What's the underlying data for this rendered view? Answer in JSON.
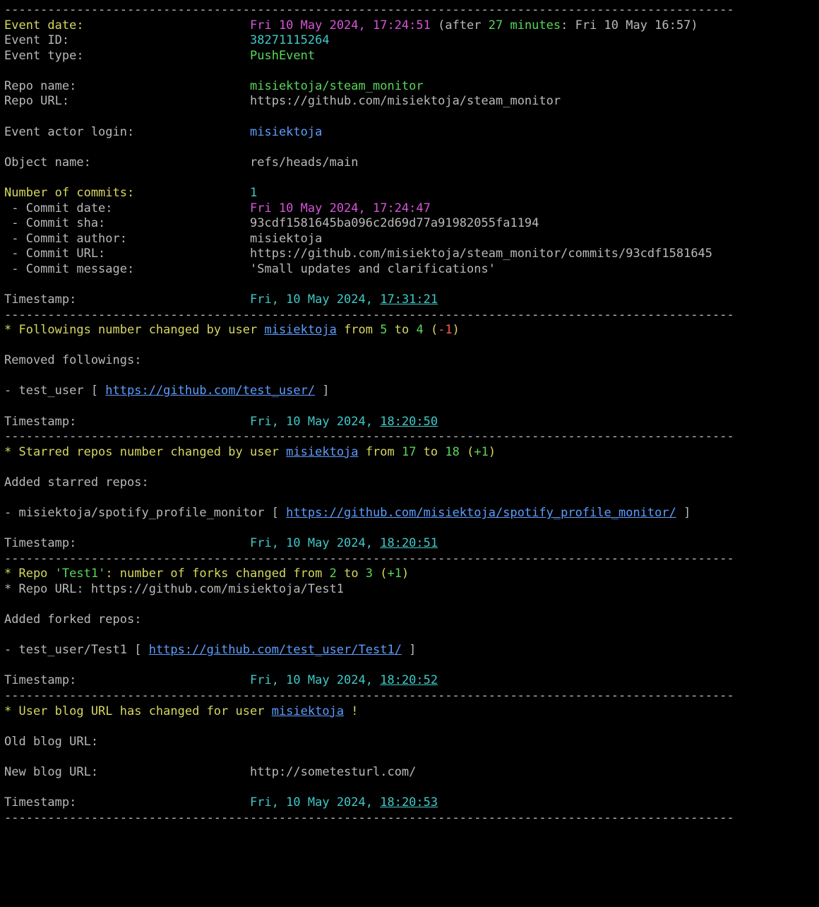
{
  "hr": "-----------------------------------------------------------------------------------------------------",
  "labels": {
    "event_date": "Event date:",
    "event_id": "Event ID:",
    "event_type": "Event type:",
    "repo_name": "Repo name:",
    "repo_url": "Repo URL:",
    "actor": "Event actor login:",
    "object_name": "Object name:",
    "num_commits": "Number of commits:",
    "commit_date": " - Commit date:",
    "commit_sha": " - Commit sha:",
    "commit_author": " - Commit author:",
    "commit_url": " - Commit URL:",
    "commit_msg": " - Commit message:",
    "timestamp": "Timestamp:",
    "removed_followings": "Removed followings:",
    "added_starred": "Added starred repos:",
    "added_forked": "Added forked repos:",
    "old_blog": "Old blog URL:",
    "new_blog": "New blog URL:"
  },
  "event": {
    "date": "Fri 10 May 2024, 17:24:51",
    "after_prefix": " (after ",
    "after_value": "27 minutes",
    "after_suffix": ": Fri 10 May 16:57)",
    "id": "38271115264",
    "type": "PushEvent",
    "repo_name": "misiektoja/steam_monitor",
    "repo_url": "https://github.com/misiektoja/steam_monitor",
    "actor": "misiektoja",
    "object_name": "refs/heads/main",
    "num_commits": "1",
    "commit_date": "Fri 10 May 2024, 17:24:47",
    "commit_sha": "93cdf1581645ba096c2d69d77a91982055fa1194",
    "commit_author": "misiektoja",
    "commit_url": "https://github.com/misiektoja/steam_monitor/commits/93cdf1581645",
    "commit_msg": "'Small updates and clarifications'",
    "ts_prefix": "Fri, 10 May 2024, ",
    "ts_time": "17:31:21"
  },
  "followings": {
    "prefix": "* Followings number changed by user ",
    "user": "misiektoja",
    "mid1": " from ",
    "from": "5",
    "mid2": " to ",
    "to": "4",
    "delta_open": " (",
    "delta": "-1",
    "delta_close": ")",
    "removed_item_prefix": "- test_user [ ",
    "removed_item_url": "https://github.com/test_user/",
    "removed_item_suffix": " ]",
    "ts_prefix": "Fri, 10 May 2024, ",
    "ts_time": "18:20:50"
  },
  "starred": {
    "prefix": "* Starred repos number changed by user ",
    "user": "misiektoja",
    "mid1": " from ",
    "from": "17",
    "mid2": " to ",
    "to": "18",
    "delta_open": " (",
    "delta": "+1",
    "delta_close": ")",
    "added_item_prefix": "- misiektoja/spotify_profile_monitor [ ",
    "added_item_url": "https://github.com/misiektoja/spotify_profile_monitor/",
    "added_item_suffix": " ]",
    "ts_prefix": "Fri, 10 May 2024, ",
    "ts_time": "18:20:51"
  },
  "forks": {
    "line1_a": "* Repo ",
    "line1_name": "'Test1'",
    "line1_b": ": number of forks changed from ",
    "from": "2",
    "mid": " to ",
    "to": "3",
    "delta_open": " (",
    "delta": "+1",
    "delta_close": ")",
    "line2": "* Repo URL: https://github.com/misiektoja/Test1",
    "added_item_prefix": "- test_user/Test1 [ ",
    "added_item_url": "https://github.com/test_user/Test1/",
    "added_item_suffix": " ]",
    "ts_prefix": "Fri, 10 May 2024, ",
    "ts_time": "18:20:52"
  },
  "blog": {
    "prefix": "* User blog URL has changed for user ",
    "user": "misiektoja",
    "bang": " !",
    "old_value": "",
    "new_value": "http://sometesturl.com/",
    "ts_prefix": "Fri, 10 May 2024, ",
    "ts_time": "18:20:53"
  },
  "pad": {
    "c34": "                                  ",
    "event_date": "                       ",
    "event_id": "                         ",
    "event_type": "                       ",
    "repo_name": "                        ",
    "repo_url": "                         ",
    "actor": "                ",
    "object_name": "                      ",
    "num_commits": "                ",
    "commit_date": "                   ",
    "commit_sha": "                    ",
    "commit_author": "                 ",
    "commit_url": "                    ",
    "commit_msg": "                ",
    "timestamp": "                        ",
    "new_blog": "                     "
  }
}
